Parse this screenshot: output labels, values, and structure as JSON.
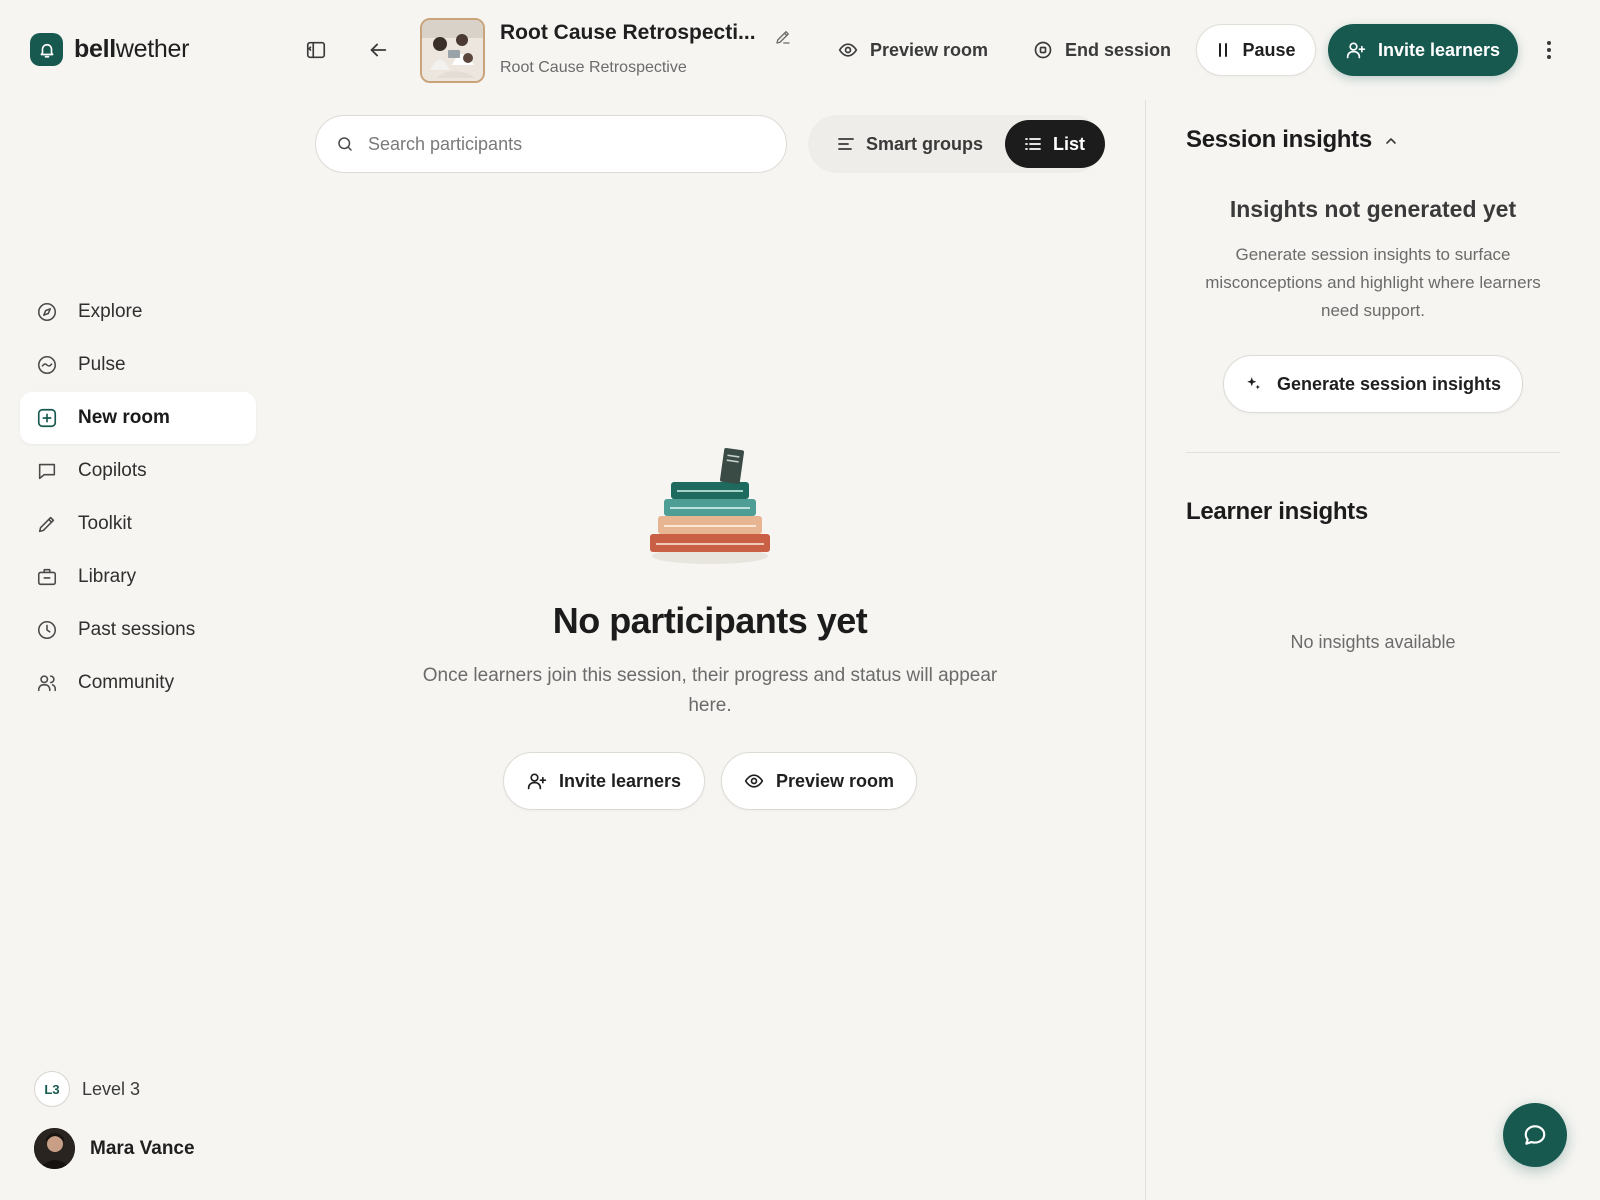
{
  "brand": {
    "name_bold": "bell",
    "name_rest": "wether",
    "color": "#17594f"
  },
  "header": {
    "room_title": "Root Cause Retrospecti...",
    "room_subtitle": "Root Cause Retrospective",
    "preview_label": "Preview room",
    "end_label": "End session",
    "pause_label": "Pause",
    "invite_label": "Invite learners",
    "icons": [
      "sidebar-toggle-icon",
      "back-arrow-icon",
      "edit-pencil-icon",
      "eye-icon",
      "stop-circle-icon",
      "pause-icon",
      "user-plus-icon",
      "more-vertical-icon"
    ]
  },
  "sidebar": {
    "items": [
      {
        "label": "Explore",
        "icon": "compass-icon",
        "active": false
      },
      {
        "label": "Pulse",
        "icon": "pulse-icon",
        "active": false
      },
      {
        "label": "New room",
        "icon": "new-room-icon",
        "active": true
      },
      {
        "label": "Copilots",
        "icon": "chat-bubble-icon",
        "active": false
      },
      {
        "label": "Toolkit",
        "icon": "pencil-icon",
        "active": false
      },
      {
        "label": "Library",
        "icon": "briefcase-icon",
        "active": false
      },
      {
        "label": "Past sessions",
        "icon": "clock-icon",
        "active": false
      },
      {
        "label": "Community",
        "icon": "users-icon",
        "active": false
      }
    ],
    "level_badge": "L3",
    "level_label": "Level 3",
    "user_name": "Mara Vance"
  },
  "toolbar": {
    "search_placeholder": "Search participants",
    "search_value": "",
    "smart_groups_label": "Smart groups",
    "list_label": "List",
    "active_view": "List"
  },
  "empty_state": {
    "title": "No participants yet",
    "description": "Once learners join this session, their progress and status will appear here.",
    "invite_label": "Invite learners",
    "preview_label": "Preview room"
  },
  "insights": {
    "session_title": "Session insights",
    "not_generated_title": "Insights not generated yet",
    "not_generated_desc": "Generate session insights to surface misconceptions and highlight where learners need support.",
    "generate_label": "Generate session insights",
    "learner_title": "Learner insights",
    "no_insights": "No insights available"
  },
  "colors": {
    "accent": "#17594f",
    "background": "#f6f5f2",
    "dark_toggle": "#1c1c1c"
  }
}
